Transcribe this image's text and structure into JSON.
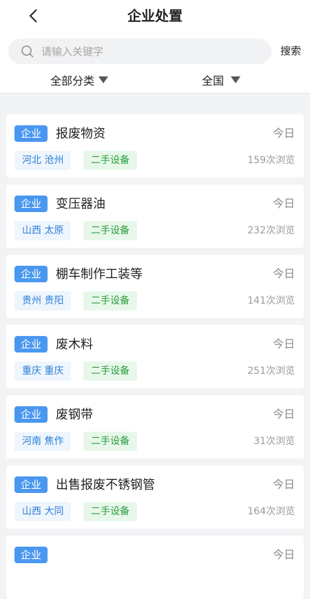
{
  "header": {
    "title": "企业处置",
    "back_icon": "chevron-left-icon"
  },
  "search": {
    "placeholder": "请输入关键字",
    "value": "",
    "button_label": "搜索",
    "icon": "search-icon"
  },
  "filters": [
    {
      "label": "全部分类",
      "icon": "caret-down-icon"
    },
    {
      "label": "全国",
      "icon": "caret-down-icon"
    }
  ],
  "colors": {
    "badge": "#4a97f0",
    "location_text": "#2d7fd7",
    "category_text": "#2a9b3c",
    "page_bg": "#f2f3f5"
  },
  "items": [
    {
      "badge": "企业",
      "title": "报废物资",
      "date": "今日",
      "location": "河北 沧州",
      "category": "二手设备",
      "views": "159次浏览"
    },
    {
      "badge": "企业",
      "title": "变压器油",
      "date": "今日",
      "location": "山西 太原",
      "category": "二手设备",
      "views": "232次浏览"
    },
    {
      "badge": "企业",
      "title": "棚车制作工装等",
      "date": "今日",
      "location": "贵州 贵阳",
      "category": "二手设备",
      "views": "141次浏览"
    },
    {
      "badge": "企业",
      "title": "废木料",
      "date": "今日",
      "location": "重庆 重庆",
      "category": "二手设备",
      "views": "251次浏览"
    },
    {
      "badge": "企业",
      "title": "废钢带",
      "date": "今日",
      "location": "河南 焦作",
      "category": "二手设备",
      "views": "31次浏览"
    },
    {
      "badge": "企业",
      "title": "出售报废不锈钢管",
      "date": "今日",
      "location": "山西 大同",
      "category": "二手设备",
      "views": "164次浏览"
    },
    {
      "badge": "企业",
      "title": "",
      "date": "今日",
      "location": "",
      "category": "",
      "views": ""
    }
  ]
}
